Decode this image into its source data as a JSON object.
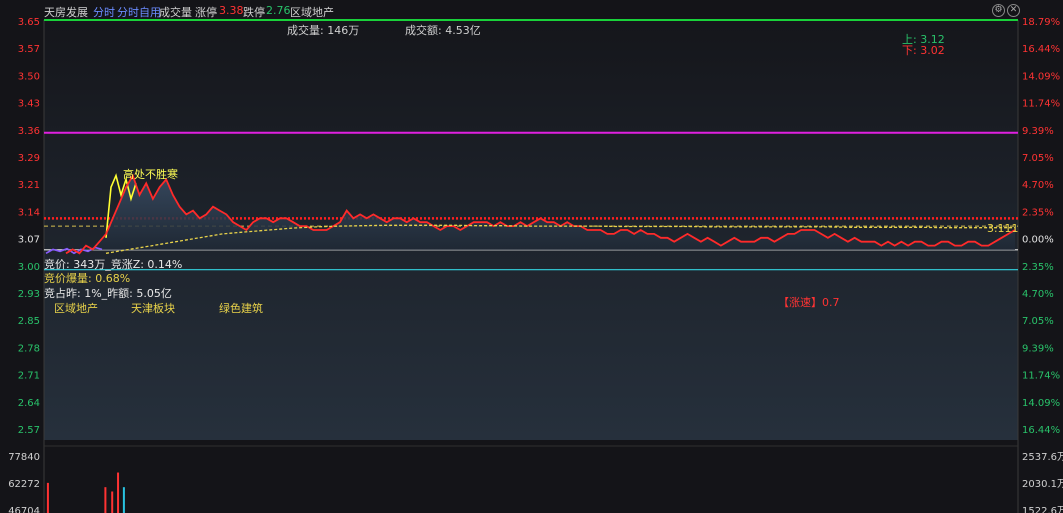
{
  "header": {
    "stock_name": "天房发展",
    "tab_intraday": "分时",
    "tab_custom": "分时自用",
    "label_volume": "成交量",
    "label_limit_up": "涨停",
    "limit_up_value": "3.38",
    "label_limit_down": "跌停",
    "limit_down_value": "2.76",
    "sector": "区域地产",
    "settings_icon": "gear-icon",
    "close_icon": "close-icon"
  },
  "info": {
    "volume_text": "成交量: 146万",
    "turnover_text": "成交额: 4.53亿",
    "upper_text": "上: 3.12",
    "lower_text": "下: 3.02",
    "auction_text": "竞价: 343万_竞涨Z: 0.14%",
    "auction_volume_text": "竞价爆量: 0.68%",
    "auction_ratio_text": "竞占昨: 1%_昨额: 5.05亿",
    "tag_region": "区域地产",
    "tag_tianjin": "天津板块",
    "tag_green": "绿色建筑",
    "speed_text": "【涨速】0.7",
    "annotation_peak": "高处不胜寒",
    "last_price_text": "3.111"
  },
  "colors": {
    "price": "#ff2a2a",
    "avg": "#e8d24a",
    "up_axis": "#ff3333",
    "down_axis": "#29c26a",
    "limit_up_line": "#19d13a",
    "magenta_line": "#e020e0",
    "cyan_line": "#34d4e0",
    "prev_close_line": "#e8e8e8",
    "auction_line": "#8a5cff",
    "peak_line": "#ffff33"
  },
  "chart_data": {
    "type": "line",
    "title": "",
    "prev_close": 3.07,
    "ylim": [
      2.57,
      3.65
    ],
    "price_ticks": [
      "3.65",
      "3.57",
      "3.50",
      "3.43",
      "3.36",
      "3.29",
      "3.21",
      "3.14",
      "3.07",
      "3.00",
      "2.93",
      "2.85",
      "2.78",
      "2.71",
      "2.64",
      "2.57"
    ],
    "pct_ticks": [
      "18.79%",
      "16.44%",
      "14.09%",
      "11.74%",
      "9.39%",
      "7.05%",
      "4.70%",
      "2.35%",
      "0.00%",
      "2.35%",
      "4.70%",
      "7.05%",
      "9.39%",
      "11.74%",
      "14.09%",
      "16.44%"
    ],
    "volume_left_ticks": [
      "77840",
      "62272",
      "46704"
    ],
    "volume_right_ticks": [
      "2537.6万",
      "2030.1万",
      "1522.6万"
    ],
    "levels": {
      "limit_up_line": 3.65,
      "magenta_line": 3.36,
      "dotted_red_line": 3.14,
      "upper_band": 3.12,
      "prev_close_line": 3.059,
      "cyan_line": 3.008
    },
    "auction_series": [
      3.05,
      3.06,
      3.055,
      3.062,
      3.05,
      3.06,
      3.055,
      3.065,
      3.06
    ],
    "peak_series": [
      3.09,
      3.22,
      3.25,
      3.2,
      3.24,
      3.19,
      3.23
    ],
    "price_series": [
      3.05,
      3.06,
      3.05,
      3.07,
      3.06,
      3.08,
      3.1,
      3.14,
      3.18,
      3.22,
      3.25,
      3.2,
      3.23,
      3.19,
      3.22,
      3.24,
      3.2,
      3.17,
      3.15,
      3.16,
      3.14,
      3.15,
      3.17,
      3.16,
      3.15,
      3.13,
      3.12,
      3.11,
      3.13,
      3.14,
      3.14,
      3.13,
      3.14,
      3.14,
      3.13,
      3.12,
      3.12,
      3.11,
      3.11,
      3.11,
      3.12,
      3.13,
      3.16,
      3.14,
      3.15,
      3.14,
      3.15,
      3.14,
      3.13,
      3.14,
      3.14,
      3.13,
      3.14,
      3.13,
      3.13,
      3.12,
      3.11,
      3.12,
      3.12,
      3.11,
      3.12,
      3.13,
      3.13,
      3.13,
      3.12,
      3.13,
      3.12,
      3.12,
      3.13,
      3.12,
      3.13,
      3.14,
      3.13,
      3.13,
      3.12,
      3.13,
      3.12,
      3.12,
      3.11,
      3.11,
      3.11,
      3.1,
      3.1,
      3.11,
      3.11,
      3.1,
      3.11,
      3.1,
      3.1,
      3.09,
      3.09,
      3.08,
      3.09,
      3.1,
      3.09,
      3.08,
      3.09,
      3.08,
      3.07,
      3.08,
      3.09,
      3.08,
      3.08,
      3.08,
      3.09,
      3.09,
      3.08,
      3.09,
      3.1,
      3.1,
      3.11,
      3.11,
      3.11,
      3.1,
      3.09,
      3.1,
      3.09,
      3.08,
      3.09,
      3.08,
      3.08,
      3.08,
      3.07,
      3.08,
      3.07,
      3.08,
      3.07,
      3.08,
      3.08,
      3.07,
      3.07,
      3.08,
      3.08,
      3.07,
      3.07,
      3.08,
      3.08,
      3.07,
      3.07,
      3.08,
      3.09,
      3.1,
      3.11
    ],
    "avg_series": [
      3.05,
      3.06,
      3.07,
      3.08,
      3.09,
      3.1,
      3.105,
      3.11,
      3.115,
      3.118,
      3.12,
      3.121,
      3.122,
      3.122,
      3.122,
      3.122,
      3.121,
      3.121,
      3.12,
      3.12,
      3.12,
      3.12,
      3.119,
      3.119,
      3.119,
      3.119,
      3.118,
      3.118,
      3.118,
      3.118,
      3.118,
      3.118,
      3.117,
      3.117,
      3.117,
      3.117,
      3.116,
      3.116,
      3.116,
      3.116
    ],
    "volume_bars": [
      {
        "x": 0.003,
        "value": 35000,
        "color": "#ff3333"
      },
      {
        "x": 0.062,
        "value": 30000,
        "color": "#ff3333"
      },
      {
        "x": 0.069,
        "value": 25000,
        "color": "#ff3333"
      },
      {
        "x": 0.075,
        "value": 47000,
        "color": "#ff3333"
      },
      {
        "x": 0.081,
        "value": 30000,
        "color": "#29c2e0"
      }
    ]
  }
}
